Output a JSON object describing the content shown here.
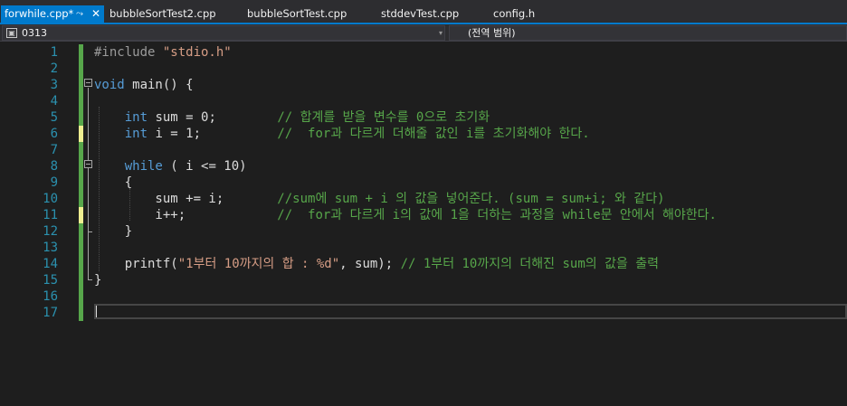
{
  "tabs": [
    {
      "label": "forwhile.cpp*",
      "active": true,
      "pinned": true
    },
    {
      "label": "bubbleSortTest2.cpp"
    },
    {
      "label": "bubbleSortTest.cpp"
    },
    {
      "label": "stddevTest.cpp"
    },
    {
      "label": "config.h"
    }
  ],
  "tab_icons": {
    "pin": "pin-icon",
    "close": "close-icon"
  },
  "nav": {
    "scope_value": "0313",
    "scope_icon": "project-icon",
    "scope_dropdown_icon": "chevron-down-icon",
    "member_value": "(전역 범위)"
  },
  "editor": {
    "line_numbers": [
      "1",
      "2",
      "3",
      "4",
      "5",
      "6",
      "7",
      "8",
      "9",
      "10",
      "11",
      "12",
      "13",
      "14",
      "15",
      "16",
      "17"
    ],
    "change_markers": {
      "saved": [
        1,
        2,
        3,
        4,
        5,
        7,
        8,
        9,
        10,
        12,
        13,
        14,
        15,
        16,
        17
      ],
      "unsaved": [
        6,
        11
      ]
    },
    "current_line": 17,
    "lines": [
      [
        {
          "t": "#include ",
          "c": "pp"
        },
        {
          "t": "\"stdio.h\"",
          "c": "str"
        }
      ],
      [],
      [
        {
          "t": "void",
          "c": "kw"
        },
        {
          "t": " main() {"
        }
      ],
      [],
      [
        {
          "t": "    "
        },
        {
          "t": "int",
          "c": "kw"
        },
        {
          "t": " sum = 0;        "
        },
        {
          "t": "// 합계를 받을 변수를 0으로 초기화",
          "c": "cm"
        }
      ],
      [
        {
          "t": "    "
        },
        {
          "t": "int",
          "c": "kw"
        },
        {
          "t": " i = 1;          "
        },
        {
          "t": "//  for과 다르게 더해줄 값인 i를 초기화해야 한다.",
          "c": "cm"
        }
      ],
      [],
      [
        {
          "t": "    "
        },
        {
          "t": "while",
          "c": "kw"
        },
        {
          "t": " ( i <= 10)"
        }
      ],
      [
        {
          "t": "    {"
        }
      ],
      [
        {
          "t": "        sum += i;       "
        },
        {
          "t": "//sum에 sum + i 의 값을 넣어준다. (sum = sum+i; 와 같다)",
          "c": "cm"
        }
      ],
      [
        {
          "t": "        i++;            "
        },
        {
          "t": "//  for과 다르게 i의 값에 1을 더하는 과정을 while문 안에서 해야한다.",
          "c": "cm"
        }
      ],
      [
        {
          "t": "    }"
        }
      ],
      [],
      [
        {
          "t": "    printf("
        },
        {
          "t": "\"1부터 10까지의 합 : %d\"",
          "c": "str"
        },
        {
          "t": ", sum); "
        },
        {
          "t": "// 1부터 10까지의 더해진 sum의 값을 출력",
          "c": "cm"
        }
      ],
      [
        {
          "t": "}"
        }
      ],
      [],
      []
    ]
  },
  "colors": {
    "tab_active": "#007acc",
    "keyword": "#569cd6",
    "string": "#d69d85",
    "comment": "#57a64a",
    "line_number": "#2b91af",
    "change_saved": "#57a64a",
    "change_unsaved": "#efef91"
  }
}
